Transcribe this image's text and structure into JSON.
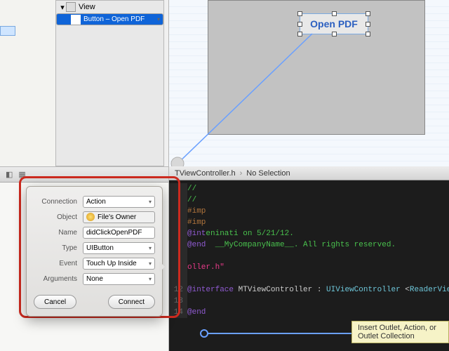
{
  "outline": {
    "view_label": "View",
    "button_label": "Button – Open PDF"
  },
  "canvas": {
    "button_text": "Open PDF"
  },
  "path": {
    "file": "TViewController.h",
    "selection": "No Selection"
  },
  "code": {
    "l1": "//",
    "l2": "//",
    "l3a": "#imp",
    "l3b": "",
    "l4a": "#imp",
    "l5a": "@int",
    "l5b": "eninati on 5/21/12.",
    "l6a": "@end",
    "l6b": "__MyCompanyName__. All rights reserved.",
    "l7": "oller.h\"",
    "l8_num": "12",
    "l8a": "@interface",
    "l8b": " MTViewController : ",
    "l8c": "UIViewController",
    "l8d": " <",
    "l8e": "ReaderViewControllerDelegate",
    "l8f": ">",
    "l9_num": "13",
    "l10_num": "14",
    "l10a": "@end"
  },
  "popover": {
    "connection_label": "Connection",
    "connection_value": "Action",
    "object_label": "Object",
    "object_value": "File's Owner",
    "name_label": "Name",
    "name_value": "didClickOpenPDF",
    "type_label": "Type",
    "type_value": "UIButton",
    "event_label": "Event",
    "event_value": "Touch Up Inside",
    "arguments_label": "Arguments",
    "arguments_value": "None",
    "cancel": "Cancel",
    "connect": "Connect"
  },
  "tooltip": "Insert Outlet, Action, or Outlet Collection"
}
